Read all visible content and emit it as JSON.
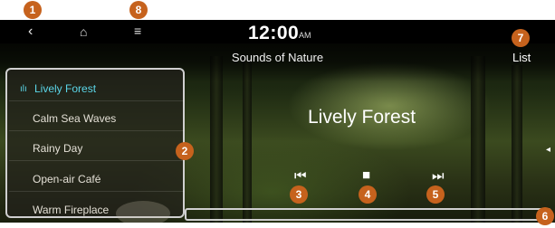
{
  "status": {
    "time": "12:00",
    "ampm": "AM"
  },
  "header": {
    "back_icon": "chevron-left-icon",
    "home_icon": "home-icon",
    "menu_icon": "menu-icon",
    "title": "Sounds of Nature",
    "list_label": "List"
  },
  "playlist": {
    "active_indicator": "ılı",
    "items": [
      {
        "label": "Lively Forest",
        "active": true
      },
      {
        "label": "Calm Sea Waves",
        "active": false
      },
      {
        "label": "Rainy Day",
        "active": false
      },
      {
        "label": "Open-air Café",
        "active": false
      },
      {
        "label": "Warm Fireplace",
        "active": false
      }
    ]
  },
  "player": {
    "track_title": "Lively Forest"
  },
  "callouts": [
    "1",
    "2",
    "3",
    "4",
    "5",
    "6",
    "7",
    "8"
  ],
  "colors": {
    "accent": "#5bd6e8",
    "callout": "#c6621d"
  }
}
